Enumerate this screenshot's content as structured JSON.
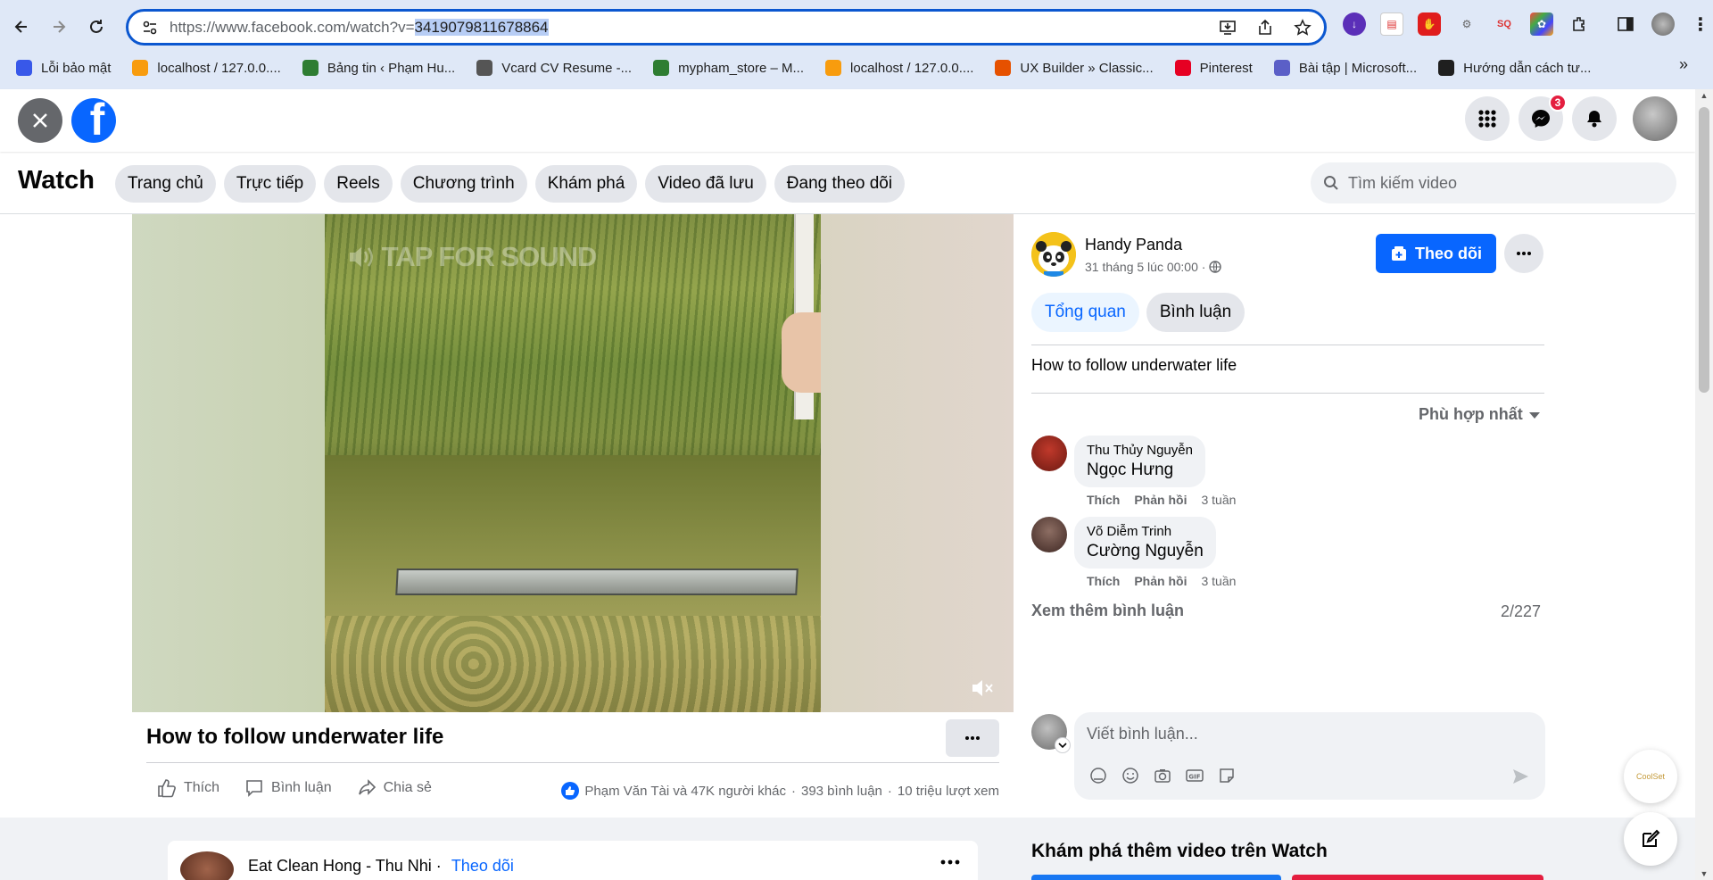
{
  "browser": {
    "url_prefix": "https://www.facebook.com/watch?v=",
    "url_selected": "3419079811678864",
    "bookmarks": [
      {
        "label": "Lỗi bảo mật",
        "icon": "wordpress-icon",
        "color": "#3858e9"
      },
      {
        "label": "localhost / 127.0.0....",
        "icon": "phpmyadmin-icon",
        "color": "#f89c0e"
      },
      {
        "label": "Bảng tin ‹ Phạm Hu...",
        "icon": "site-icon",
        "color": "#2e7d32"
      },
      {
        "label": "Vcard CV Resume -...",
        "icon": "wordpress-icon",
        "color": "#555555"
      },
      {
        "label": "mypham_store – M...",
        "icon": "site-icon",
        "color": "#2e7d32"
      },
      {
        "label": "localhost / 127.0.0....",
        "icon": "phpmyadmin-icon",
        "color": "#f89c0e"
      },
      {
        "label": "UX Builder » Classic...",
        "icon": "uxbuilder-icon",
        "color": "#e65100"
      },
      {
        "label": "Pinterest",
        "icon": "pinterest-icon",
        "color": "#e60023"
      },
      {
        "label": "Bài tập | Microsoft...",
        "icon": "teams-icon",
        "color": "#5b5fc7"
      },
      {
        "label": "Hướng dẫn cách tư...",
        "icon": "github-icon",
        "color": "#1f1f1f"
      }
    ],
    "bookmarks_more": "»"
  },
  "fb_header": {
    "messenger_badge": "3",
    "logo_letter": "f"
  },
  "watch_bar": {
    "title": "Watch",
    "tabs": [
      "Trang chủ",
      "Trực tiếp",
      "Reels",
      "Chương trình",
      "Khám phá",
      "Video đã lưu",
      "Đang theo dõi"
    ],
    "search_placeholder": "Tìm kiếm video"
  },
  "video": {
    "overlay_text": "TAP FOR SOUND",
    "title": "How to follow underwater life",
    "actions": {
      "like": "Thích",
      "comment": "Bình luận",
      "share": "Chia sẻ"
    },
    "stats": {
      "reactors": "Phạm Văn Tài và 47K người khác",
      "sep": "·",
      "comments": "393 bình luận",
      "views": "10 triệu lượt xem"
    }
  },
  "side_panel": {
    "page_name": "Handy Panda",
    "post_time": "31 tháng 5 lúc 00:00 ·",
    "follow_label": "Theo dõi",
    "tabs": {
      "overview": "Tổng quan",
      "comments": "Bình luận"
    },
    "description": "How to follow underwater life",
    "sort_label": "Phù hợp nhất",
    "comments": [
      {
        "author": "Thu Thủy Nguyễn",
        "text": "Ngọc Hưng",
        "like": "Thích",
        "reply": "Phản hồi",
        "time": "3 tuần"
      },
      {
        "author": "Võ Diễm Trinh",
        "text": "Cường Nguyễn",
        "like": "Thích",
        "reply": "Phản hồi",
        "time": "3 tuần"
      }
    ],
    "see_more": "Xem thêm bình luận",
    "count": "2/227",
    "composer_placeholder": "Viết bình luận..."
  },
  "feed": {
    "author": "Eat Clean Hong - Thu Nhi",
    "sep": "·",
    "follow": "Theo dõi",
    "explore_title": "Khám phá thêm video trên Watch"
  },
  "floating": {
    "brand_text": "CoolSet"
  },
  "colors": {
    "fb_blue": "#0866ff",
    "chrome_bar": "#dfe8f7",
    "badge_red": "#e41e3f"
  }
}
